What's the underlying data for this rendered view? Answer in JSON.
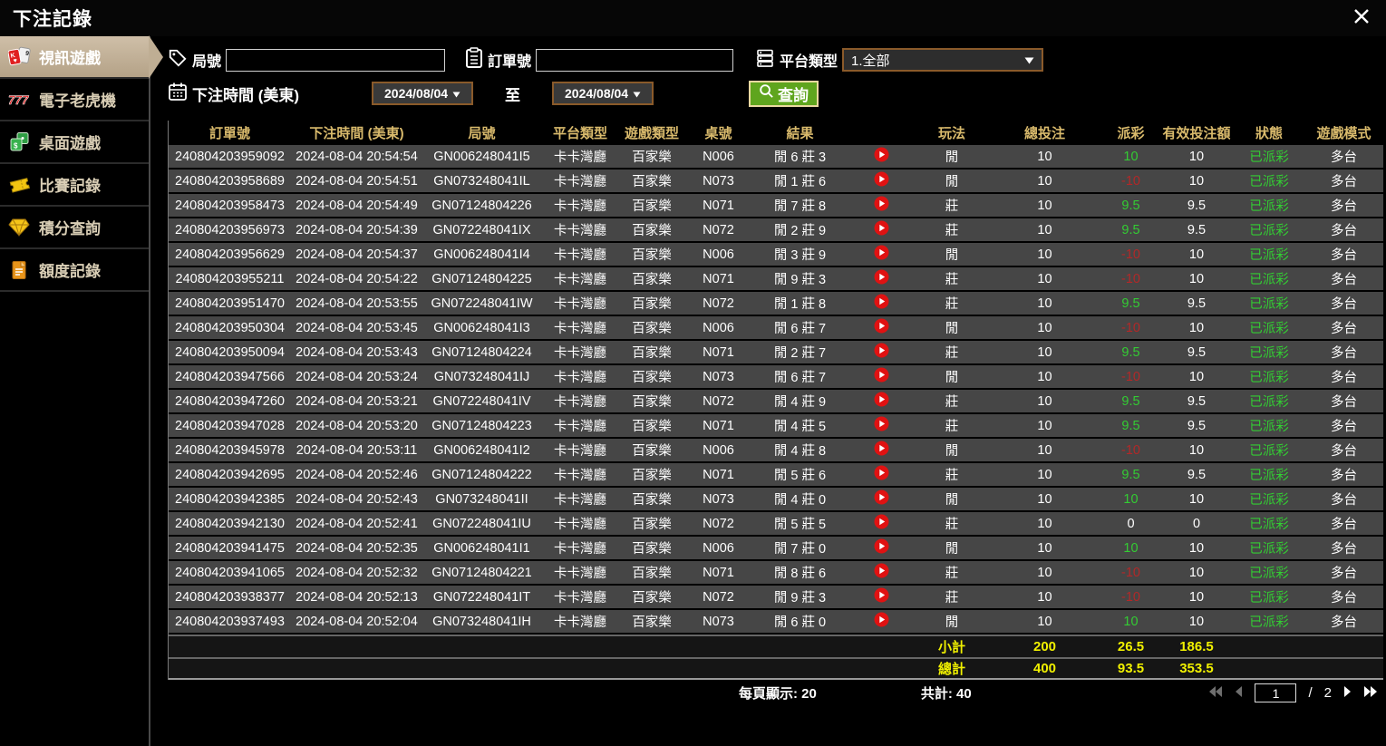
{
  "title": "下注記錄",
  "sidebar": {
    "items": [
      {
        "label": "視訊遊戲",
        "icon": "video-cards-icon",
        "active": true
      },
      {
        "label": "電子老虎機",
        "icon": "slot-777-icon",
        "active": false
      },
      {
        "label": "桌面遊戲",
        "icon": "table-games-icon",
        "active": false
      },
      {
        "label": "比賽記錄",
        "icon": "ticket-icon",
        "active": false
      },
      {
        "label": "積分查詢",
        "icon": "gem-icon",
        "active": false
      },
      {
        "label": "額度記錄",
        "icon": "document-icon",
        "active": false
      }
    ]
  },
  "filters": {
    "round_label": "局號",
    "round_value": "",
    "order_label": "訂單號",
    "order_value": "",
    "platform_label": "平台類型",
    "platform_value": "1.全部",
    "bet_time_label": "下注時間 (美東)",
    "date_from": "2024/08/04",
    "to_label": "至",
    "date_to": "2024/08/04",
    "search_label": "查詢"
  },
  "table": {
    "columns": [
      "訂單號",
      "下注時間 (美東)",
      "局號",
      "平台類型",
      "遊戲類型",
      "桌號",
      "結果",
      "",
      "玩法",
      "總投注",
      "派彩",
      "有效投注額",
      "狀態",
      "遊戲模式"
    ],
    "rows": [
      {
        "order_id": "240804203959092",
        "bet_time": "2024-08-04 20:54:54",
        "round_id": "GN006248041I5",
        "platform": "卡卡灣廳",
        "game_type": "百家樂",
        "table_no": "N006",
        "result": "閒 6 莊 3",
        "play": "閒",
        "total_bet": "10",
        "payout": "10",
        "valid_bet": "10",
        "status": "已派彩",
        "mode": "多台"
      },
      {
        "order_id": "240804203958689",
        "bet_time": "2024-08-04 20:54:51",
        "round_id": "GN073248041IL",
        "platform": "卡卡灣廳",
        "game_type": "百家樂",
        "table_no": "N073",
        "result": "閒 1 莊 6",
        "play": "閒",
        "total_bet": "10",
        "payout": "-10",
        "valid_bet": "10",
        "status": "已派彩",
        "mode": "多台"
      },
      {
        "order_id": "240804203958473",
        "bet_time": "2024-08-04 20:54:49",
        "round_id": "GN07124804226",
        "platform": "卡卡灣廳",
        "game_type": "百家樂",
        "table_no": "N071",
        "result": "閒 7 莊 8",
        "play": "莊",
        "total_bet": "10",
        "payout": "9.5",
        "valid_bet": "9.5",
        "status": "已派彩",
        "mode": "多台"
      },
      {
        "order_id": "240804203956973",
        "bet_time": "2024-08-04 20:54:39",
        "round_id": "GN072248041IX",
        "platform": "卡卡灣廳",
        "game_type": "百家樂",
        "table_no": "N072",
        "result": "閒 2 莊 9",
        "play": "莊",
        "total_bet": "10",
        "payout": "9.5",
        "valid_bet": "9.5",
        "status": "已派彩",
        "mode": "多台"
      },
      {
        "order_id": "240804203956629",
        "bet_time": "2024-08-04 20:54:37",
        "round_id": "GN006248041I4",
        "platform": "卡卡灣廳",
        "game_type": "百家樂",
        "table_no": "N006",
        "result": "閒 3 莊 9",
        "play": "閒",
        "total_bet": "10",
        "payout": "-10",
        "valid_bet": "10",
        "status": "已派彩",
        "mode": "多台"
      },
      {
        "order_id": "240804203955211",
        "bet_time": "2024-08-04 20:54:22",
        "round_id": "GN07124804225",
        "platform": "卡卡灣廳",
        "game_type": "百家樂",
        "table_no": "N071",
        "result": "閒 9 莊 3",
        "play": "莊",
        "total_bet": "10",
        "payout": "-10",
        "valid_bet": "10",
        "status": "已派彩",
        "mode": "多台"
      },
      {
        "order_id": "240804203951470",
        "bet_time": "2024-08-04 20:53:55",
        "round_id": "GN072248041IW",
        "platform": "卡卡灣廳",
        "game_type": "百家樂",
        "table_no": "N072",
        "result": "閒 1 莊 8",
        "play": "莊",
        "total_bet": "10",
        "payout": "9.5",
        "valid_bet": "9.5",
        "status": "已派彩",
        "mode": "多台"
      },
      {
        "order_id": "240804203950304",
        "bet_time": "2024-08-04 20:53:45",
        "round_id": "GN006248041I3",
        "platform": "卡卡灣廳",
        "game_type": "百家樂",
        "table_no": "N006",
        "result": "閒 6 莊 7",
        "play": "閒",
        "total_bet": "10",
        "payout": "-10",
        "valid_bet": "10",
        "status": "已派彩",
        "mode": "多台"
      },
      {
        "order_id": "240804203950094",
        "bet_time": "2024-08-04 20:53:43",
        "round_id": "GN07124804224",
        "platform": "卡卡灣廳",
        "game_type": "百家樂",
        "table_no": "N071",
        "result": "閒 2 莊 7",
        "play": "莊",
        "total_bet": "10",
        "payout": "9.5",
        "valid_bet": "9.5",
        "status": "已派彩",
        "mode": "多台"
      },
      {
        "order_id": "240804203947566",
        "bet_time": "2024-08-04 20:53:24",
        "round_id": "GN073248041IJ",
        "platform": "卡卡灣廳",
        "game_type": "百家樂",
        "table_no": "N073",
        "result": "閒 6 莊 7",
        "play": "閒",
        "total_bet": "10",
        "payout": "-10",
        "valid_bet": "10",
        "status": "已派彩",
        "mode": "多台"
      },
      {
        "order_id": "240804203947260",
        "bet_time": "2024-08-04 20:53:21",
        "round_id": "GN072248041IV",
        "platform": "卡卡灣廳",
        "game_type": "百家樂",
        "table_no": "N072",
        "result": "閒 4 莊 9",
        "play": "莊",
        "total_bet": "10",
        "payout": "9.5",
        "valid_bet": "9.5",
        "status": "已派彩",
        "mode": "多台"
      },
      {
        "order_id": "240804203947028",
        "bet_time": "2024-08-04 20:53:20",
        "round_id": "GN07124804223",
        "platform": "卡卡灣廳",
        "game_type": "百家樂",
        "table_no": "N071",
        "result": "閒 4 莊 5",
        "play": "莊",
        "total_bet": "10",
        "payout": "9.5",
        "valid_bet": "9.5",
        "status": "已派彩",
        "mode": "多台"
      },
      {
        "order_id": "240804203945978",
        "bet_time": "2024-08-04 20:53:11",
        "round_id": "GN006248041I2",
        "platform": "卡卡灣廳",
        "game_type": "百家樂",
        "table_no": "N006",
        "result": "閒 4 莊 8",
        "play": "閒",
        "total_bet": "10",
        "payout": "-10",
        "valid_bet": "10",
        "status": "已派彩",
        "mode": "多台"
      },
      {
        "order_id": "240804203942695",
        "bet_time": "2024-08-04 20:52:46",
        "round_id": "GN07124804222",
        "platform": "卡卡灣廳",
        "game_type": "百家樂",
        "table_no": "N071",
        "result": "閒 5 莊 6",
        "play": "莊",
        "total_bet": "10",
        "payout": "9.5",
        "valid_bet": "9.5",
        "status": "已派彩",
        "mode": "多台"
      },
      {
        "order_id": "240804203942385",
        "bet_time": "2024-08-04 20:52:43",
        "round_id": "GN073248041II",
        "platform": "卡卡灣廳",
        "game_type": "百家樂",
        "table_no": "N073",
        "result": "閒 4 莊 0",
        "play": "閒",
        "total_bet": "10",
        "payout": "10",
        "valid_bet": "10",
        "status": "已派彩",
        "mode": "多台"
      },
      {
        "order_id": "240804203942130",
        "bet_time": "2024-08-04 20:52:41",
        "round_id": "GN072248041IU",
        "platform": "卡卡灣廳",
        "game_type": "百家樂",
        "table_no": "N072",
        "result": "閒 5 莊 5",
        "play": "莊",
        "total_bet": "10",
        "payout": "0",
        "valid_bet": "0",
        "status": "已派彩",
        "mode": "多台"
      },
      {
        "order_id": "240804203941475",
        "bet_time": "2024-08-04 20:52:35",
        "round_id": "GN006248041I1",
        "platform": "卡卡灣廳",
        "game_type": "百家樂",
        "table_no": "N006",
        "result": "閒 7 莊 0",
        "play": "閒",
        "total_bet": "10",
        "payout": "10",
        "valid_bet": "10",
        "status": "已派彩",
        "mode": "多台"
      },
      {
        "order_id": "240804203941065",
        "bet_time": "2024-08-04 20:52:32",
        "round_id": "GN07124804221",
        "platform": "卡卡灣廳",
        "game_type": "百家樂",
        "table_no": "N071",
        "result": "閒 8 莊 6",
        "play": "莊",
        "total_bet": "10",
        "payout": "-10",
        "valid_bet": "10",
        "status": "已派彩",
        "mode": "多台"
      },
      {
        "order_id": "240804203938377",
        "bet_time": "2024-08-04 20:52:13",
        "round_id": "GN072248041IT",
        "platform": "卡卡灣廳",
        "game_type": "百家樂",
        "table_no": "N072",
        "result": "閒 9 莊 3",
        "play": "莊",
        "total_bet": "10",
        "payout": "-10",
        "valid_bet": "10",
        "status": "已派彩",
        "mode": "多台"
      },
      {
        "order_id": "240804203937493",
        "bet_time": "2024-08-04 20:52:04",
        "round_id": "GN073248041IH",
        "platform": "卡卡灣廳",
        "game_type": "百家樂",
        "table_no": "N073",
        "result": "閒 6 莊 0",
        "play": "閒",
        "total_bet": "10",
        "payout": "10",
        "valid_bet": "10",
        "status": "已派彩",
        "mode": "多台"
      }
    ],
    "subtotal": {
      "label": "小計",
      "total_bet": "200",
      "payout": "26.5",
      "valid_bet": "186.5"
    },
    "grand_total": {
      "label": "總計",
      "total_bet": "400",
      "payout": "93.5",
      "valid_bet": "353.5"
    }
  },
  "footer": {
    "per_page_label": "每頁顯示: 20",
    "total_count_label": "共計: 40",
    "current_page": "1",
    "page_separator": "/",
    "total_pages": "2"
  },
  "colors": {
    "header_gold": "#d9ba6c",
    "win_green": "#33cc33",
    "loss_red": "#b22828",
    "summary_yellow": "#f0f000",
    "active_tab_tan": "#bfae94",
    "search_button_green": "#5fa51e",
    "dropdown_border_brown": "#8a5a2a"
  }
}
